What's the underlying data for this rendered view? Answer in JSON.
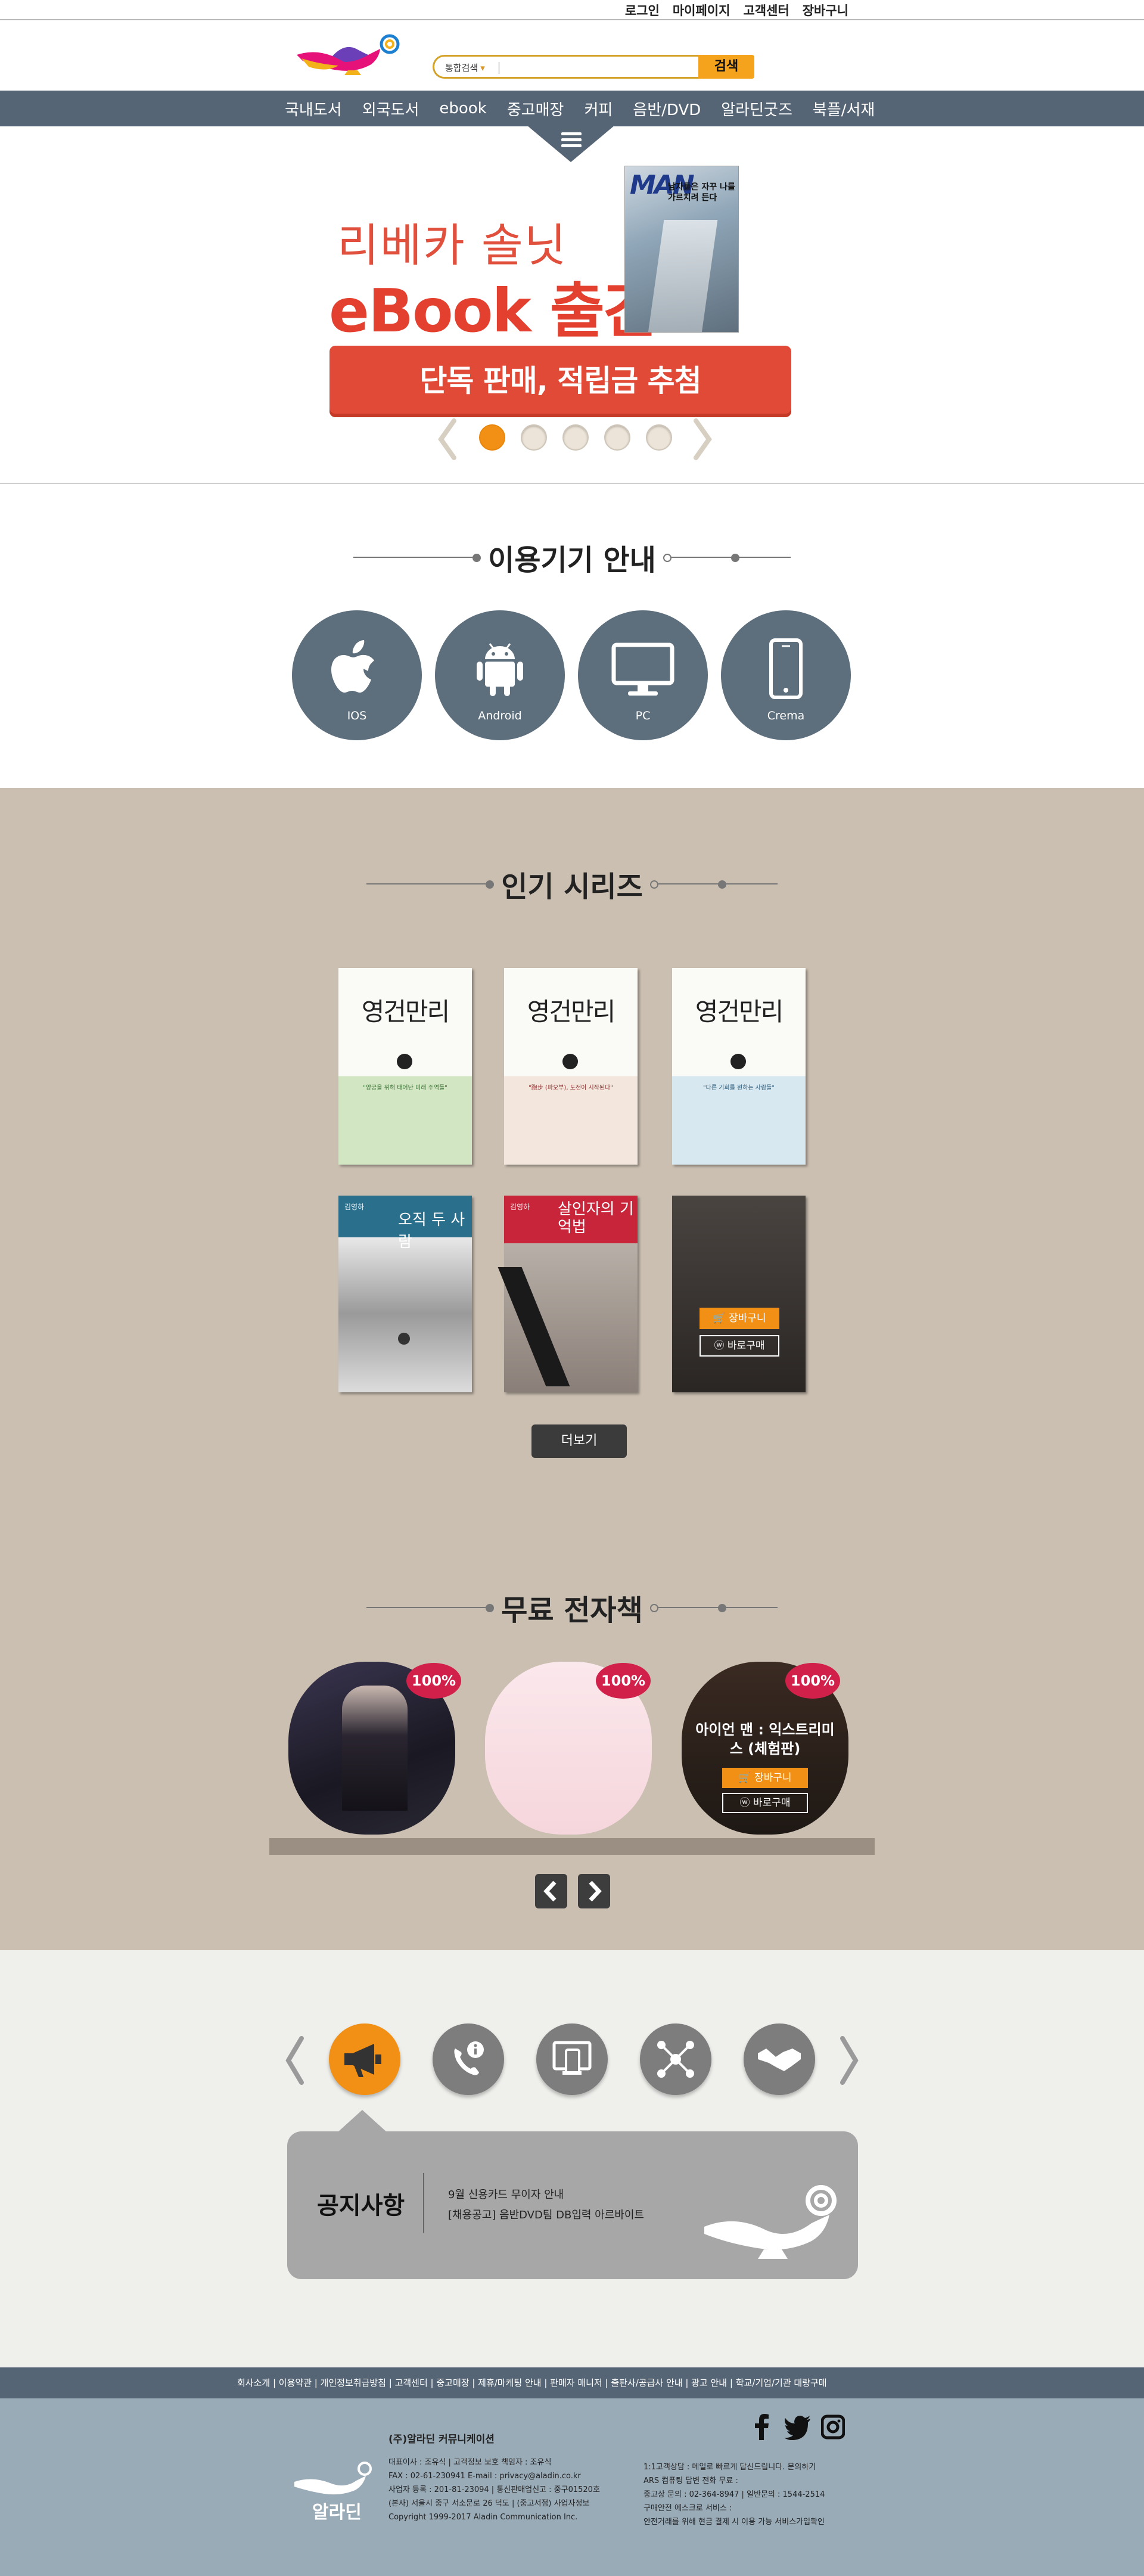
{
  "top_links": [
    "로그인",
    "마이페이지",
    "고객센터",
    "장바구니"
  ],
  "search": {
    "scope": "통합검색",
    "placeholder": "",
    "button": "검색"
  },
  "nav": [
    "국내도서",
    "외국도서",
    "ebook",
    "중고매장",
    "커피",
    "음반/DVD",
    "알라딘굿즈",
    "북플/서재"
  ],
  "banner": {
    "author": "리베카 솔닛",
    "headline": "eBook 출간",
    "book_title": "MAN",
    "book_subtitle": "남자들은 자꾸 나를 가르치려 든다",
    "cta": "단독 판매, 적립금 추첨",
    "slide_count": 5,
    "active_slide": 1
  },
  "devices_section": {
    "title": "이용기기 안내",
    "items": [
      {
        "label": "IOS",
        "icon": "apple-icon"
      },
      {
        "label": "Android",
        "icon": "android-icon"
      },
      {
        "label": "PC",
        "icon": "monitor-icon"
      },
      {
        "label": "Crema",
        "icon": "phone-icon"
      }
    ]
  },
  "series_section": {
    "title": "인기 시리즈",
    "books": [
      {
        "title": "영건만리",
        "quote": "\"양궁을 위해 태어난 미래 주역들\"",
        "color": "#d3e6c4"
      },
      {
        "title": "영건만리",
        "quote": "\"跑步 (파오부), 도전이 시작된다\"",
        "color": "#f3e6dd"
      },
      {
        "title": "영건만리",
        "quote": "\"다른 기회를 원하는 사람들\"",
        "color": "#d8e8f0"
      },
      {
        "title": "오직 두 사람",
        "author": "김영하"
      },
      {
        "title": "살인자의 기억법",
        "author": "김영하"
      },
      {
        "title": "",
        "cart": "장바구니",
        "buy": "바로구매"
      }
    ],
    "more_button": "더보기"
  },
  "free_section": {
    "title": "무료 전자책",
    "items": [
      {
        "badge": "100%"
      },
      {
        "badge": "100%"
      },
      {
        "badge": "100%",
        "title": "아이언 맨 : 익스트리미스 (체험판)",
        "cart": "장바구니",
        "buy": "바로구매"
      }
    ]
  },
  "service_icons": [
    "megaphone-icon",
    "phone-info-icon",
    "tablet-icon",
    "network-icon",
    "handshake-icon"
  ],
  "notice": {
    "title": "공지사항",
    "items": [
      "9월 신용카드 무이자 안내",
      "[채용공고] 음반DVD팀 DB입력 아르바이트"
    ]
  },
  "footer_links": "회사소개 | 이용약관 | 개인정보취급방침 | 고객센터 | 중고매장 | 제휴/마케팅 안내 | 판매자 매니저 | 출판사/공급사 안내 | 광고 안내 | 학교/기업/기관 대량구매",
  "footer": {
    "company": "(주)알라딘 커뮤니케이션",
    "address": "대표이사 : 조유식 | 고객정보 보호 책임자 : 조유식\nFAX : 02-61-230941 E-mail : privacy@aladin.co.kr\n사업자 등록 : 201-81-23094 | 통신판매업신고 : 중구01520호\n(본사) 서울시 중구 서소문로 26 덕도 | (중고서점) 사업자정보\nCopyright 1999-2017 Aladin Communication Inc.",
    "cs": "1:1고객상담 : 메일로 빠르게 답신드립니다. 문의하기\nARS 컴퓨팅 답변 전화 무료 :\n중고상 문의 : 02-364-8947 | 일반문의 : 1544-2514\n구매안전 에스크로 서비스 :\n안전거래를 위해 현금 결제 시 이용 가능 서비스가입확인",
    "brand": "알라딘",
    "social": [
      "facebook-icon",
      "twitter-icon",
      "instagram-icon"
    ]
  },
  "colors": {
    "accent": "#f29015",
    "nav": "#556575",
    "cta": "#e04a36",
    "series_bg": "#cbbfb1",
    "badge": "#d1204a"
  }
}
